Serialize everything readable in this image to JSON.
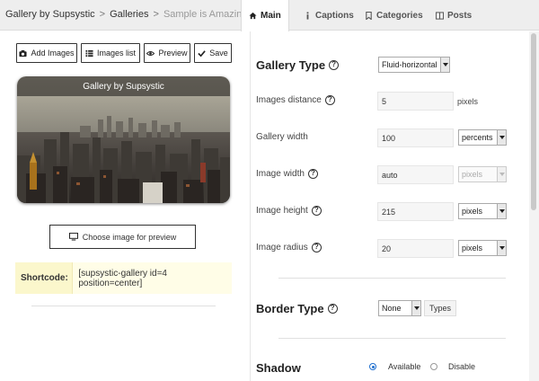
{
  "breadcrumb": {
    "root": "Gallery by Supsystic",
    "section": "Galleries",
    "current": "Sample is Amazing",
    "separator": ">"
  },
  "tabs": [
    {
      "label": "Main",
      "icon": "home-icon",
      "active": true
    },
    {
      "label": "Captions",
      "icon": "info-icon",
      "active": false
    },
    {
      "label": "Categories",
      "icon": "bookmark-icon",
      "active": false
    },
    {
      "label": "Posts",
      "icon": "columns-icon",
      "active": false
    }
  ],
  "toolbar": {
    "add_images": "Add Images",
    "images_list": "Images list",
    "preview": "Preview",
    "save": "Save"
  },
  "preview": {
    "caption": "Gallery by Supsystic",
    "choose_button": "Choose image for preview"
  },
  "shortcode": {
    "label": "Shortcode:",
    "value": "[supsystic-gallery id=4 position=center]"
  },
  "settings": {
    "gallery_type": {
      "label": "Gallery Type",
      "value": "Fluid-horizontal"
    },
    "images_distance": {
      "label": "Images distance",
      "value": "5",
      "unit": "pixels"
    },
    "gallery_width": {
      "label": "Gallery width",
      "value": "100",
      "unit": "percents"
    },
    "image_width": {
      "label": "Image width",
      "value": "auto",
      "unit": "pixels"
    },
    "image_height": {
      "label": "Image height",
      "value": "215",
      "unit": "pixels"
    },
    "image_radius": {
      "label": "Image radius",
      "value": "20",
      "unit": "pixels"
    },
    "border_type": {
      "label": "Border Type",
      "value": "None",
      "extra": "Types"
    },
    "shadow": {
      "label": "Shadow",
      "options": [
        "Available",
        "Disable"
      ],
      "selected": "Available"
    }
  },
  "colors": {
    "shortcode_bg": "#fbf7cc",
    "accent": "#1f6fcf"
  }
}
